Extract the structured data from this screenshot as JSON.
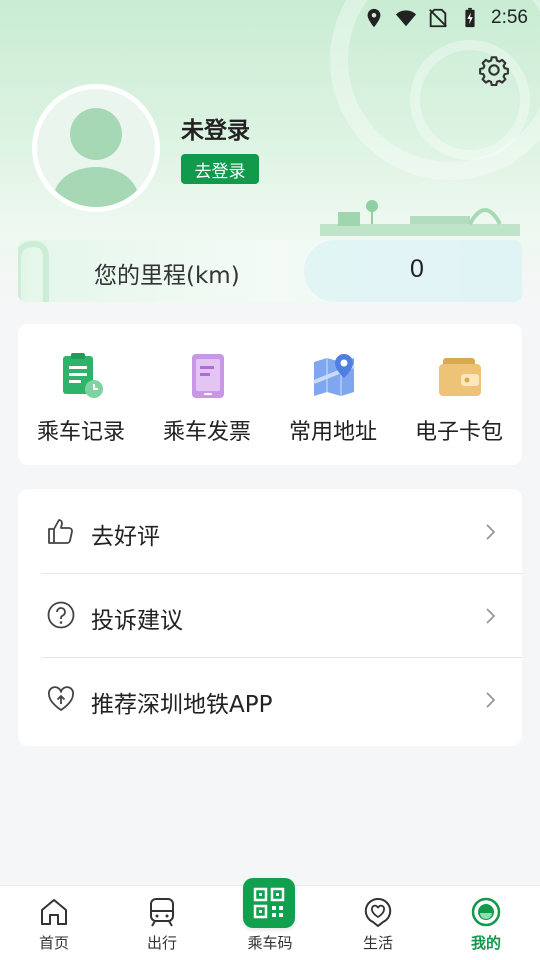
{
  "status_bar": {
    "time": "2:56",
    "icons": [
      "location-icon",
      "wifi-icon",
      "no-sim-icon",
      "battery-charging-icon"
    ]
  },
  "header": {
    "settings_icon": "gear-icon",
    "user_name": "未登录",
    "login_button": "去登录"
  },
  "mileage": {
    "label": "您的里程(km)",
    "value": "0"
  },
  "quick_actions": [
    {
      "label": "乘车记录",
      "icon": "ride-record-icon",
      "color": "#2fb36b"
    },
    {
      "label": "乘车发票",
      "icon": "invoice-icon",
      "color": "#b87ad9"
    },
    {
      "label": "常用地址",
      "icon": "map-address-icon",
      "color": "#5b8de8"
    },
    {
      "label": "电子卡包",
      "icon": "wallet-icon",
      "color": "#e3b45c"
    }
  ],
  "menu": [
    {
      "label": "去好评",
      "icon": "thumbs-up-icon"
    },
    {
      "label": "投诉建议",
      "icon": "question-circle-icon"
    },
    {
      "label": "推荐深圳地铁APP",
      "icon": "heart-share-icon"
    }
  ],
  "bottom_nav": [
    {
      "label": "首页",
      "icon": "home-icon"
    },
    {
      "label": "出行",
      "icon": "train-icon"
    },
    {
      "label": "乘车码",
      "icon": "qr-code-icon"
    },
    {
      "label": "生活",
      "icon": "heart-location-icon"
    },
    {
      "label": "我的",
      "icon": "profile-icon",
      "active": true
    }
  ],
  "colors": {
    "brand_green": "#119a4b",
    "background": "#f5f6f7"
  }
}
